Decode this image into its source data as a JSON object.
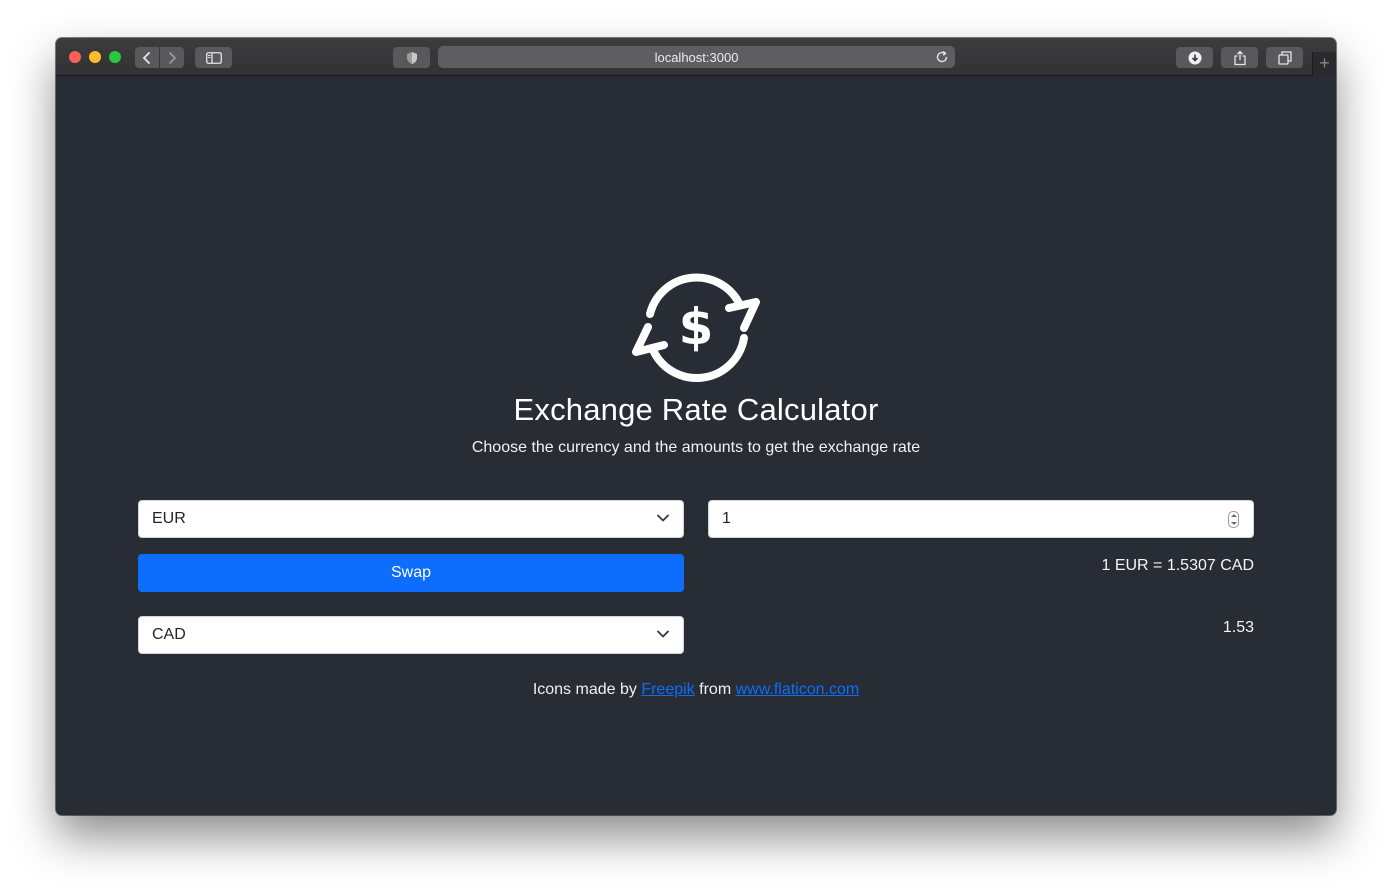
{
  "browser": {
    "url": "localhost:3000"
  },
  "app": {
    "title": "Exchange Rate Calculator",
    "subtitle": "Choose the currency and the amounts to get the exchange rate",
    "logo_icon": "currency-exchange-icon"
  },
  "converter": {
    "from_currency": "EUR",
    "to_currency": "CAD",
    "amount": "1",
    "swap_label": "Swap",
    "rate_text": "1 EUR = 1.5307 CAD",
    "result": "1.53"
  },
  "credits": {
    "prefix": "Icons made by",
    "author_link": "Freepik",
    "middle": "from",
    "site_link": "www.flaticon.com"
  },
  "colors": {
    "background": "#282c34",
    "primary": "#0d6efd",
    "text": "#ffffff"
  }
}
